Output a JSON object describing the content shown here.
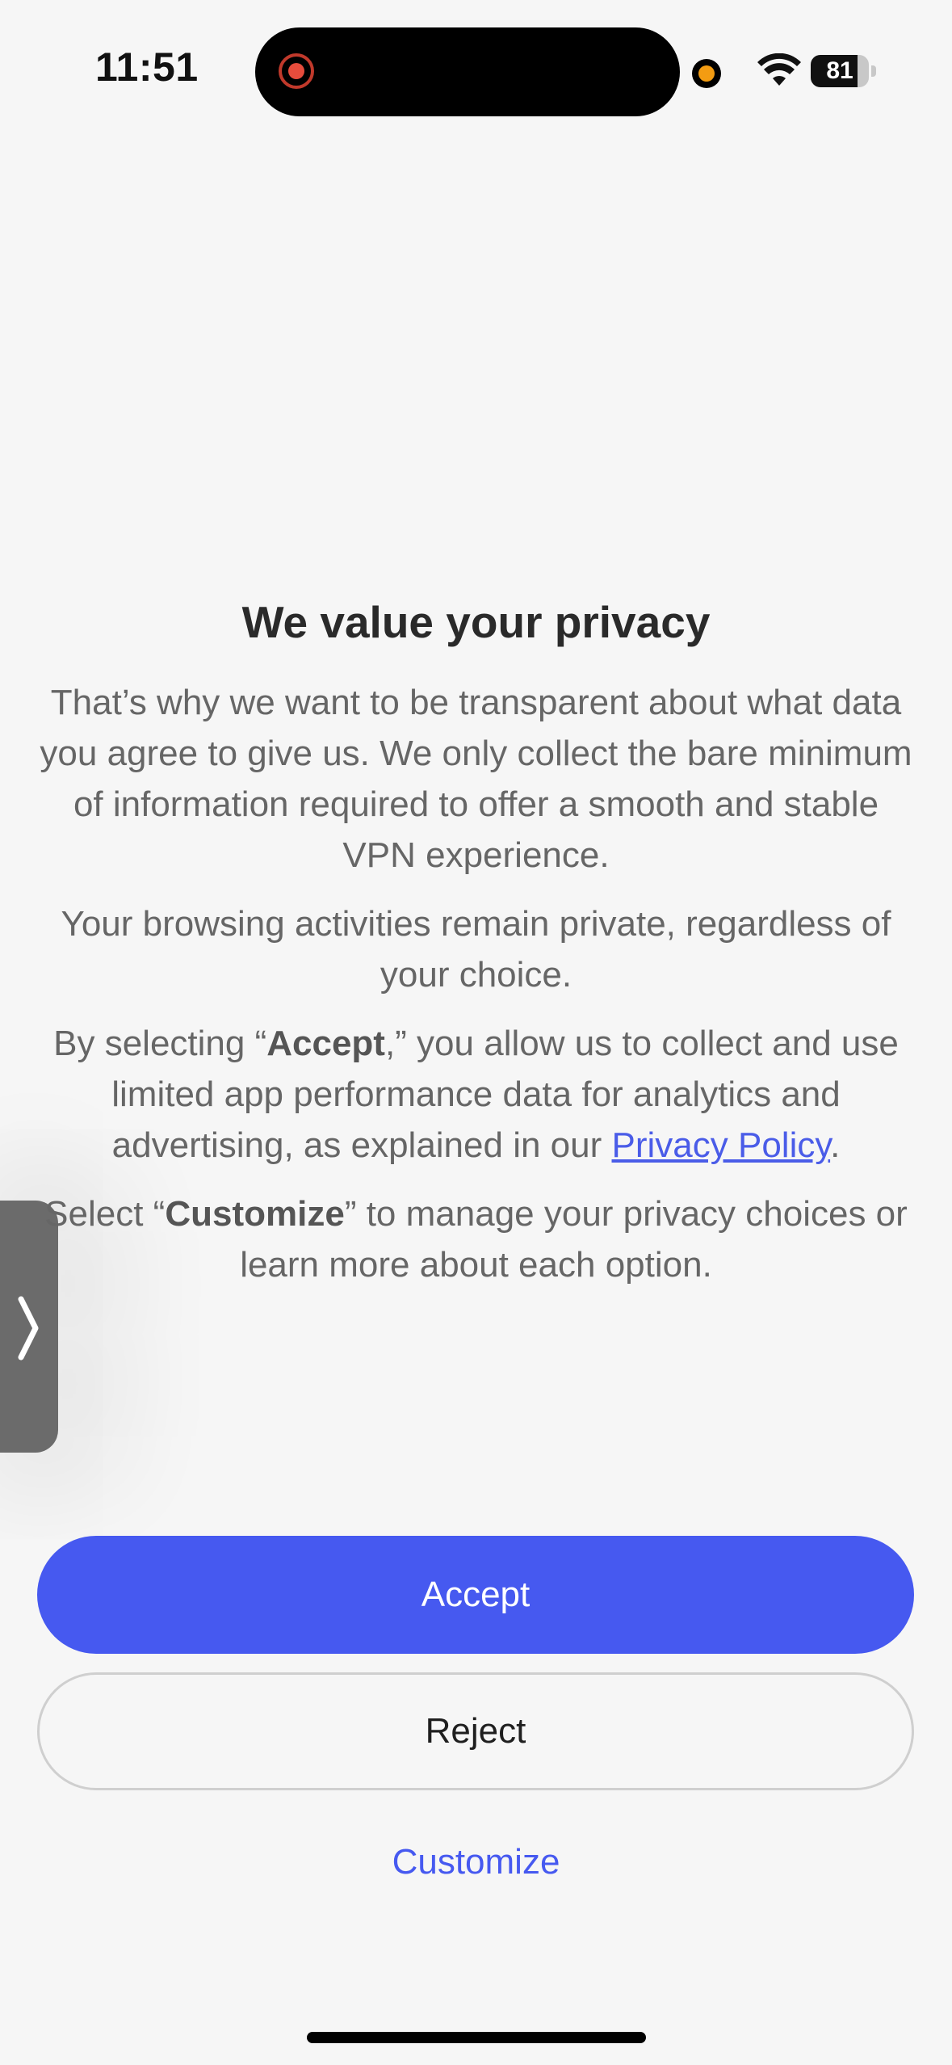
{
  "status_bar": {
    "time": "11:51",
    "battery": {
      "level": 81,
      "label": "81"
    },
    "icons": [
      "screen-recording-icon",
      "microphone-indicator-icon",
      "wifi-icon",
      "battery-icon"
    ]
  },
  "dialog": {
    "title": "We value your privacy",
    "p1": "That’s why we want to be transparent about what data you agree to give us. We only collect the bare minimum of information required to offer a smooth and stable VPN experience.",
    "p2": "Your browsing activities remain private, regardless of your choice.",
    "p3_pre": "By selecting “",
    "p3_bold": "Accept",
    "p3_mid": ",” you allow us to collect and use limited app performance data for analytics and advertising, as explained in our ",
    "p3_link": "Privacy Policy",
    "p3_post": ".",
    "p4_pre": "Select “",
    "p4_bold": "Customize",
    "p4_post": "” to manage your privacy choices or learn more about each option."
  },
  "actions": {
    "accept_label": "Accept",
    "reject_label": "Reject",
    "customize_label": "Customize"
  },
  "colors": {
    "accent": "#4659f0",
    "link": "#4a5ce8",
    "background": "#f6f6f6"
  }
}
